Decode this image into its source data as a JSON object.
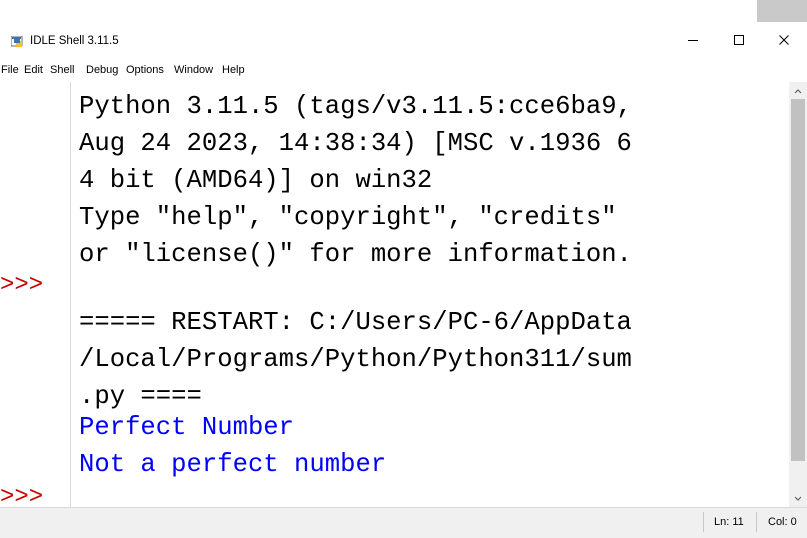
{
  "window": {
    "title": "IDLE Shell 3.11.5",
    "controls": {
      "minimize": "—",
      "maximize": "☐",
      "close": "✕"
    }
  },
  "menu": {
    "items": [
      "File",
      "Edit",
      "Shell",
      "Debug",
      "Options",
      "Window",
      "Help"
    ]
  },
  "shell": {
    "prompt": ">>>",
    "lines": [
      {
        "text": "Python 3.11.5 (tags/v3.11.5:cce6ba9,",
        "style": "default"
      },
      {
        "text": "Aug 24 2023, 14:38:34) [MSC v.1936 6",
        "style": "default"
      },
      {
        "text": "4 bit (AMD64)] on win32",
        "style": "default"
      },
      {
        "text": "Type \"help\", \"copyright\", \"credits\"",
        "style": "default"
      },
      {
        "text": "or \"license()\" for more information.",
        "style": "default"
      },
      {
        "text": "",
        "style": "default"
      },
      {
        "text": "===== RESTART: C:/Users/PC-6/AppData",
        "style": "default"
      },
      {
        "text": "/Local/Programs/Python/Python311/sum",
        "style": "default"
      },
      {
        "text": ".py ====",
        "style": "default"
      },
      {
        "text": "Perfect Number",
        "style": "output"
      },
      {
        "text": "Not a perfect number",
        "style": "output"
      }
    ]
  },
  "status": {
    "line": "Ln: 11",
    "col": "Col: 0"
  },
  "colors": {
    "prompt": "#c80000",
    "output": "#0000ff",
    "text": "#000000"
  }
}
